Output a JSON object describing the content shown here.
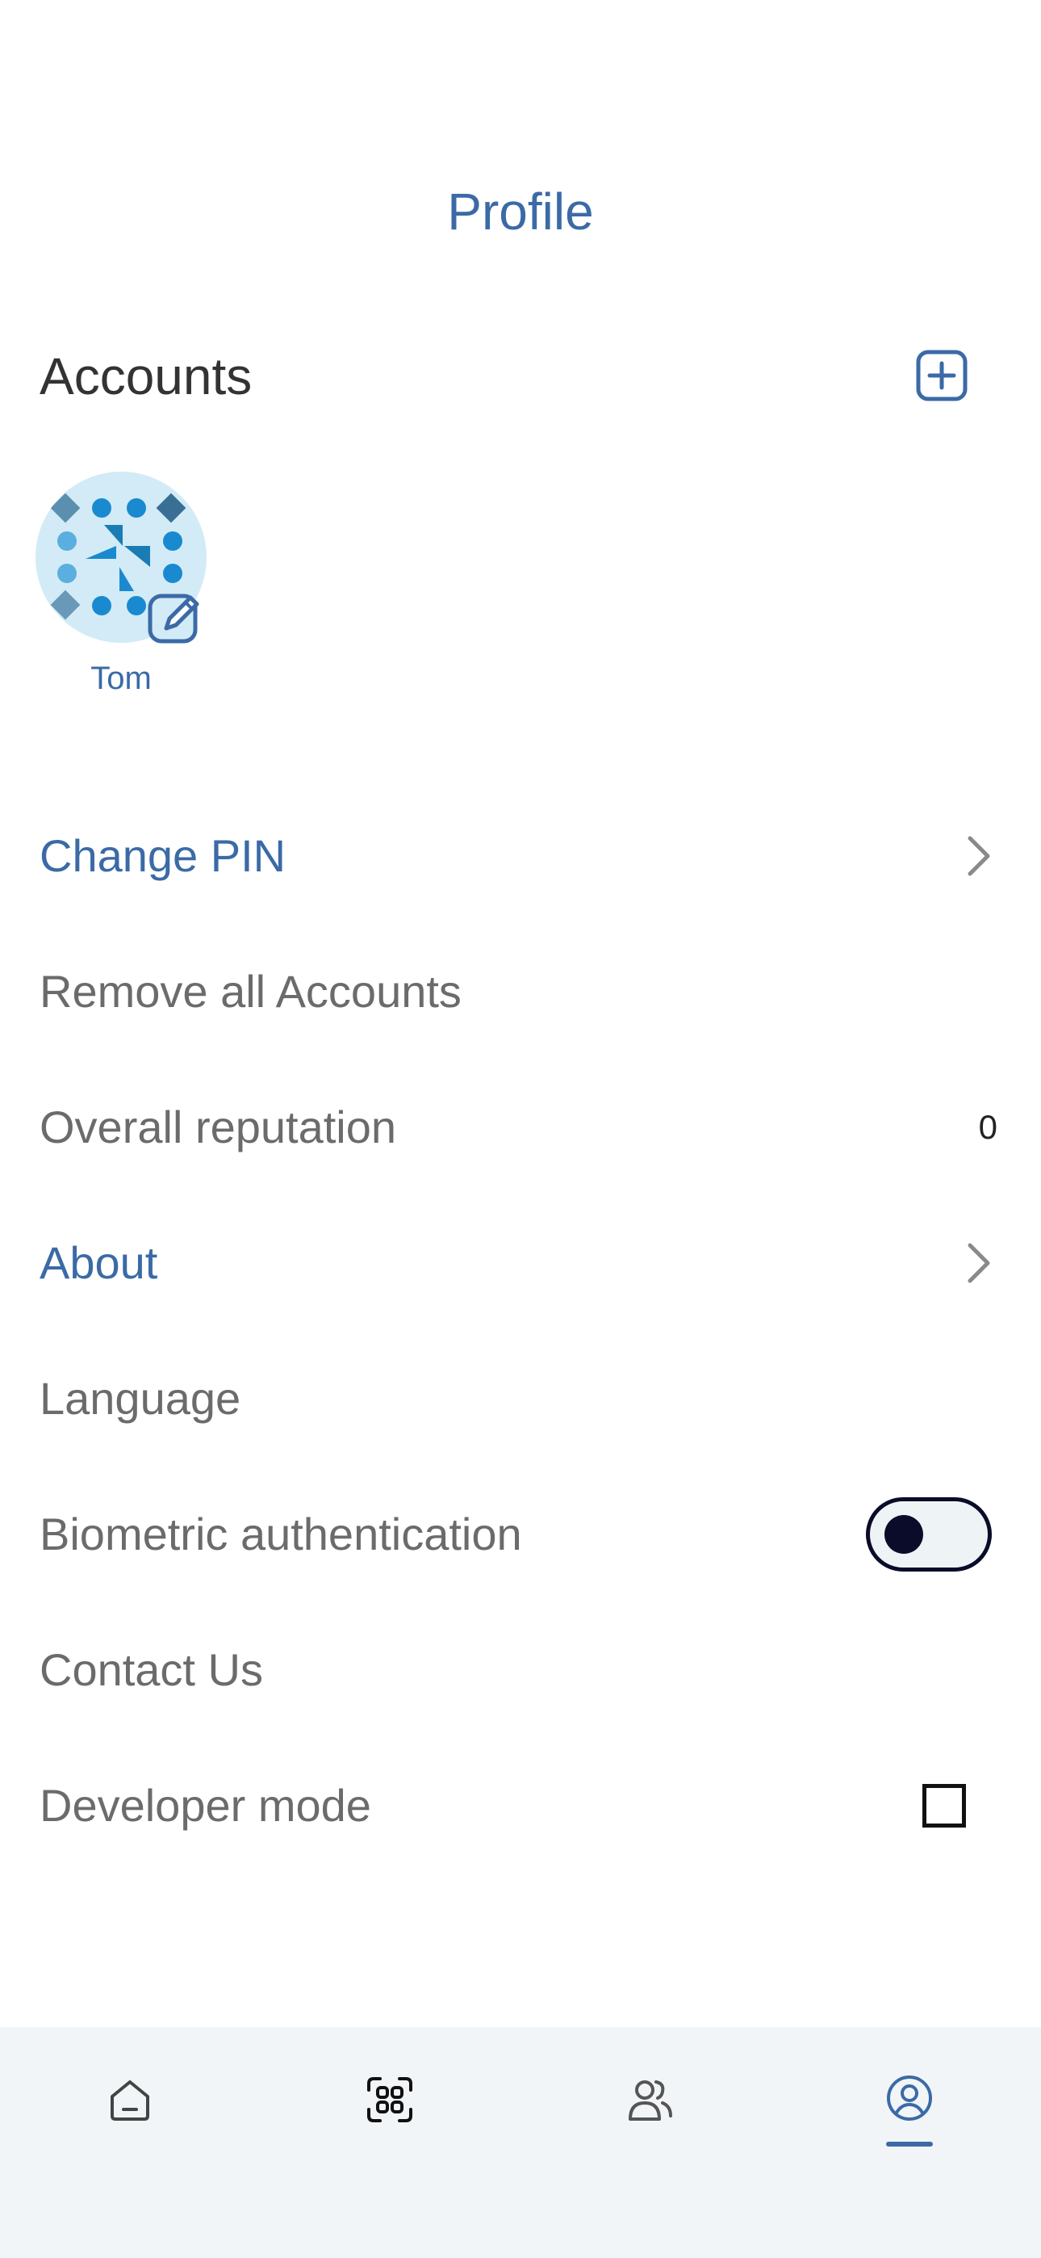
{
  "header": {
    "title": "Profile"
  },
  "accounts": {
    "title": "Accounts",
    "items": [
      {
        "name": "Tom"
      }
    ]
  },
  "settings": {
    "change_pin": "Change PIN",
    "remove_all": "Remove all Accounts",
    "reputation_label": "Overall reputation",
    "reputation_value": "0",
    "about": "About",
    "language": "Language",
    "biometric": "Biometric authentication",
    "biometric_enabled": false,
    "contact": "Contact Us",
    "developer_mode": "Developer mode",
    "developer_mode_checked": false
  },
  "tabbar": {
    "tabs": [
      {
        "icon": "home-icon"
      },
      {
        "icon": "scan-icon"
      },
      {
        "icon": "contacts-icon"
      },
      {
        "icon": "profile-icon",
        "active": true
      }
    ]
  },
  "colors": {
    "accent": "#3b6aa6",
    "text_muted": "#6b6b6b",
    "tabbar_bg": "#f2f5f7",
    "toggle_dark": "#0b0b2a"
  }
}
